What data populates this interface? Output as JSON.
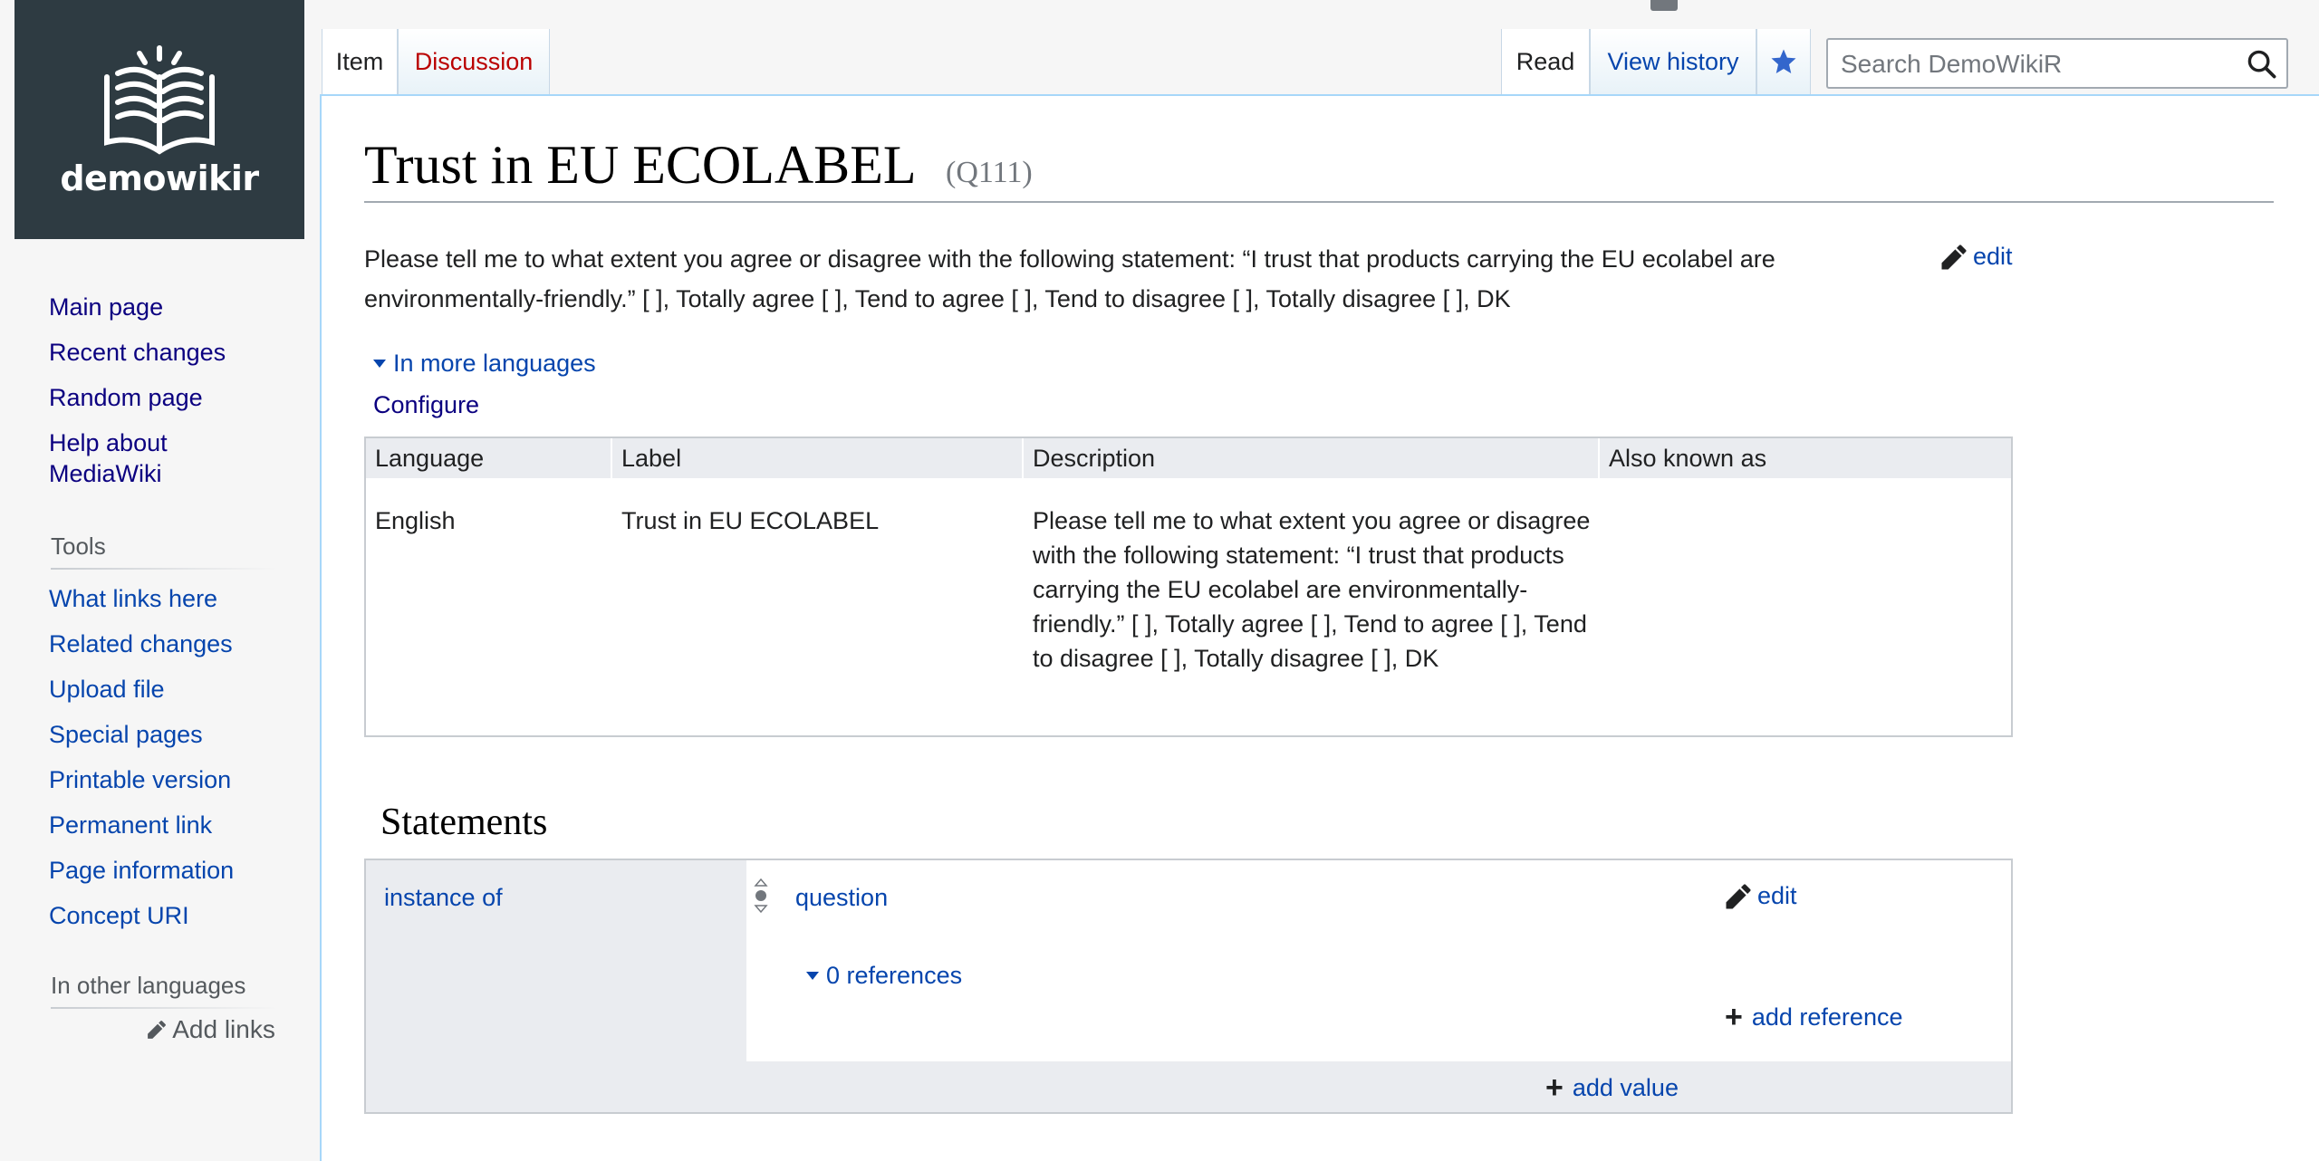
{
  "logo": {
    "text": "demowikir"
  },
  "sidebar": {
    "main": [
      {
        "label": "Main page"
      },
      {
        "label": "Recent changes"
      },
      {
        "label": "Random page"
      },
      {
        "label": "Help about MediaWiki"
      }
    ],
    "tools_heading": "Tools",
    "tools": [
      {
        "label": "What links here"
      },
      {
        "label": "Related changes"
      },
      {
        "label": "Upload file"
      },
      {
        "label": "Special pages"
      },
      {
        "label": "Printable version"
      },
      {
        "label": "Permanent link"
      },
      {
        "label": "Page information"
      },
      {
        "label": "Concept URI"
      }
    ],
    "languages_heading": "In other languages",
    "add_links": "Add links"
  },
  "tabs": {
    "item": "Item",
    "discussion": "Discussion",
    "read": "Read",
    "view_history": "View history"
  },
  "search": {
    "placeholder": "Search DemoWikiR"
  },
  "page": {
    "title": "Trust in EU ECOLABEL",
    "id": "(Q111)",
    "description": "Please tell me to what extent you agree or disagree with the following statement: “I trust that products carrying the EU ecolabel are environmentally-friendly.” [ ], Totally agree [ ], Tend to agree [ ], Tend to disagree [ ], Totally disagree [ ], DK",
    "edit": "edit",
    "more_languages": "In more languages",
    "configure": "Configure"
  },
  "lang_table": {
    "headers": [
      "Language",
      "Label",
      "Description",
      "Also known as"
    ],
    "rows": [
      {
        "language": "English",
        "label": "Trust in EU ECOLABEL",
        "description": "Please tell me to what extent you agree or disagree with the following statement: “I trust that products carrying the EU ecolabel are environmentally-friendly.” [ ], Totally agree [ ], Tend to agree [ ], Tend to disagree [ ], Totally disagree [ ], DK",
        "aliases": ""
      }
    ]
  },
  "statements": {
    "heading": "Statements",
    "property": "instance of",
    "value": "question",
    "edit": "edit",
    "references": "0 references",
    "add_reference": "add reference",
    "add_value": "add value"
  },
  "colors": {
    "link": "#0645ad",
    "new_link": "#ba0000",
    "logo_bg": "#2e3b42",
    "border": "#a7d7f9"
  }
}
